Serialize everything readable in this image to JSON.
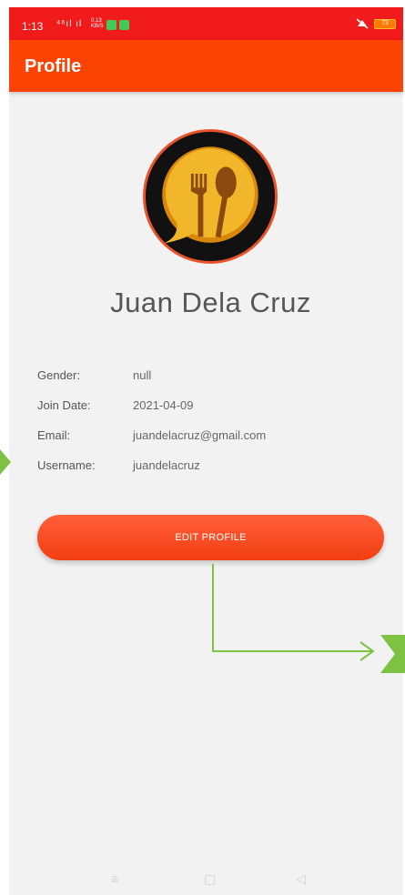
{
  "status_bar": {
    "time": "1:13",
    "signal": "⁴⁶ıl ıl",
    "speed": "0.13",
    "speed_unit": "KB/S",
    "battery": "73"
  },
  "app_bar": {
    "title": "Profile"
  },
  "profile": {
    "name": "Juan Dela Cruz",
    "fields": [
      {
        "label": "Gender:",
        "value": "null"
      },
      {
        "label": "Join Date:",
        "value": "2021-04-09"
      },
      {
        "label": "Email:",
        "value": "juandelacruz@gmail.com"
      },
      {
        "label": "Username:",
        "value": "juandelacruz"
      }
    ]
  },
  "edit_button": {
    "label": "EDIT PROFILE"
  },
  "nav": {
    "menu_icon": "≡",
    "home_icon": "▢",
    "back_icon": "◁"
  },
  "annotation": {
    "arrow_color": "#7dc242"
  },
  "colors": {
    "status_bar": "#f21b1b",
    "app_bar": "#fb4304",
    "button": "#f23f12",
    "background": "#f2f2f2"
  }
}
